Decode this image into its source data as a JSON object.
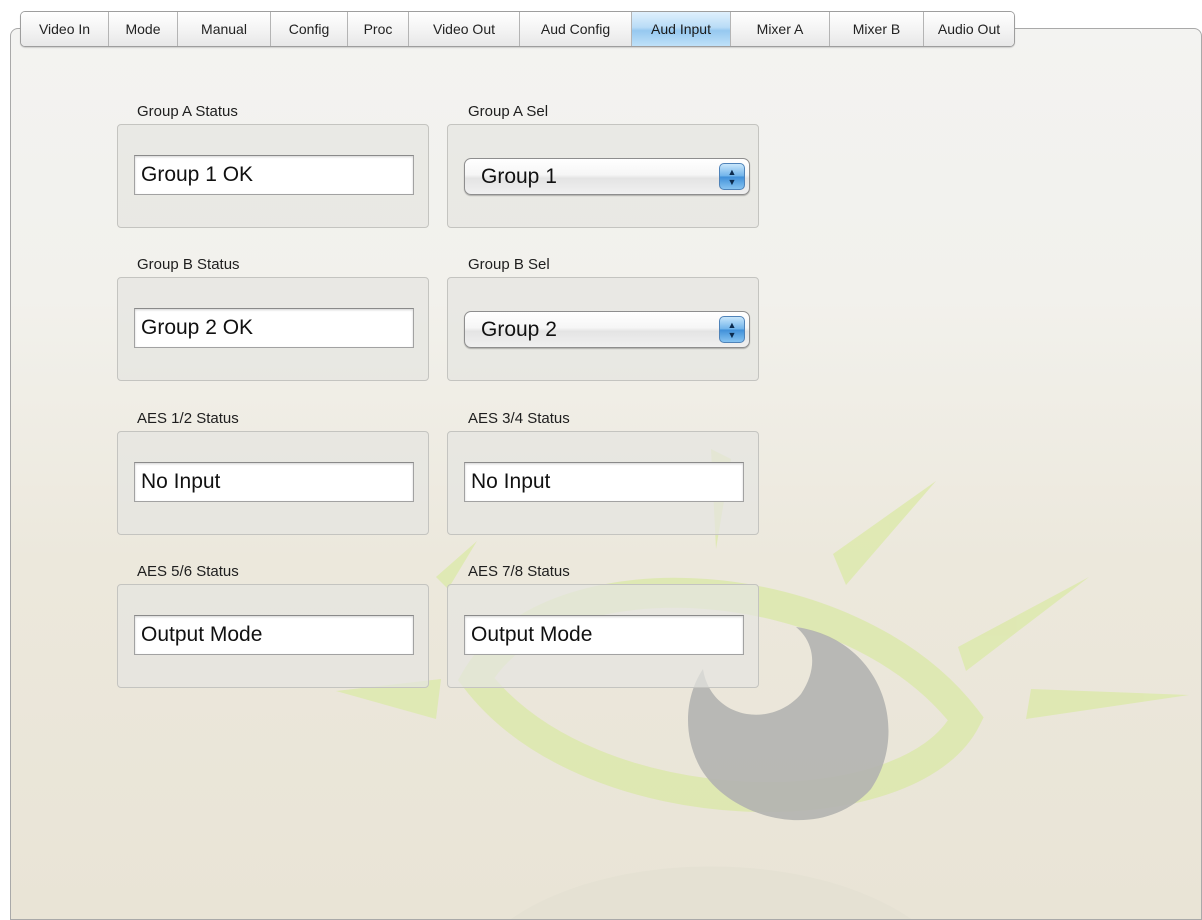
{
  "tabs": [
    {
      "label": "Video In",
      "active": false
    },
    {
      "label": "Mode",
      "active": false
    },
    {
      "label": "Manual",
      "active": false
    },
    {
      "label": "Config",
      "active": false
    },
    {
      "label": "Proc",
      "active": false
    },
    {
      "label": "Video Out",
      "active": false
    },
    {
      "label": "Aud Config",
      "active": false
    },
    {
      "label": "Aud Input",
      "active": true
    },
    {
      "label": "Mixer A",
      "active": false
    },
    {
      "label": "Mixer B",
      "active": false
    },
    {
      "label": "Audio Out",
      "active": false
    }
  ],
  "fields": {
    "group_a_status": {
      "label": "Group A Status",
      "value": "Group 1 OK"
    },
    "group_a_sel": {
      "label": "Group A Sel",
      "value": "Group 1"
    },
    "group_b_status": {
      "label": "Group B Status",
      "value": "Group 2 OK"
    },
    "group_b_sel": {
      "label": "Group B Sel",
      "value": "Group 2"
    },
    "aes_12_status": {
      "label": "AES 1/2 Status",
      "value": "No Input"
    },
    "aes_34_status": {
      "label": "AES 3/4 Status",
      "value": "No Input"
    },
    "aes_56_status": {
      "label": "AES 5/6 Status",
      "value": "Output Mode"
    },
    "aes_78_status": {
      "label": "AES 7/8 Status",
      "value": "Output Mode"
    }
  },
  "icons": {
    "select_arrows": "up-down-chevron-icon",
    "watermark": "eye-logo"
  },
  "colors": {
    "active_tab": "#a9d4f5",
    "watermark_green": "#d9e6a6",
    "watermark_gray": "#b4b4b1"
  }
}
